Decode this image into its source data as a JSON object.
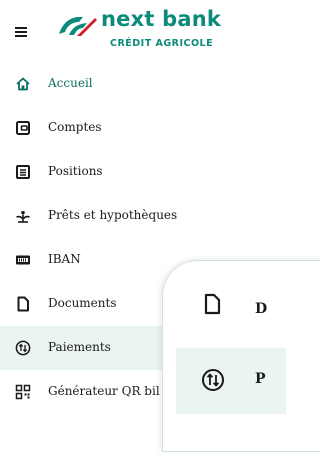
{
  "header": {
    "brand": "next bank",
    "brand_sub": "CRÉDIT AGRICOLE"
  },
  "menu": {
    "items": [
      {
        "label": "Accueil",
        "icon": "home-icon"
      },
      {
        "label": "Comptes",
        "icon": "wallet-icon"
      },
      {
        "label": "Positions",
        "icon": "list-icon"
      },
      {
        "label": "Prêts et hypothèques",
        "icon": "plant-icon"
      },
      {
        "label": "IBAN",
        "icon": "iban-icon"
      },
      {
        "label": "Documents",
        "icon": "document-icon"
      },
      {
        "label": "Paiements",
        "icon": "transfer-icon"
      },
      {
        "label": "Générateur QR bil",
        "icon": "qr-icon"
      }
    ]
  },
  "popup": {
    "items": [
      {
        "label": "D",
        "icon": "document-icon"
      },
      {
        "label": "P",
        "icon": "transfer-icon"
      }
    ]
  },
  "colors": {
    "brand": "#0c8a7a",
    "active_bg": "#eaf4f2"
  }
}
